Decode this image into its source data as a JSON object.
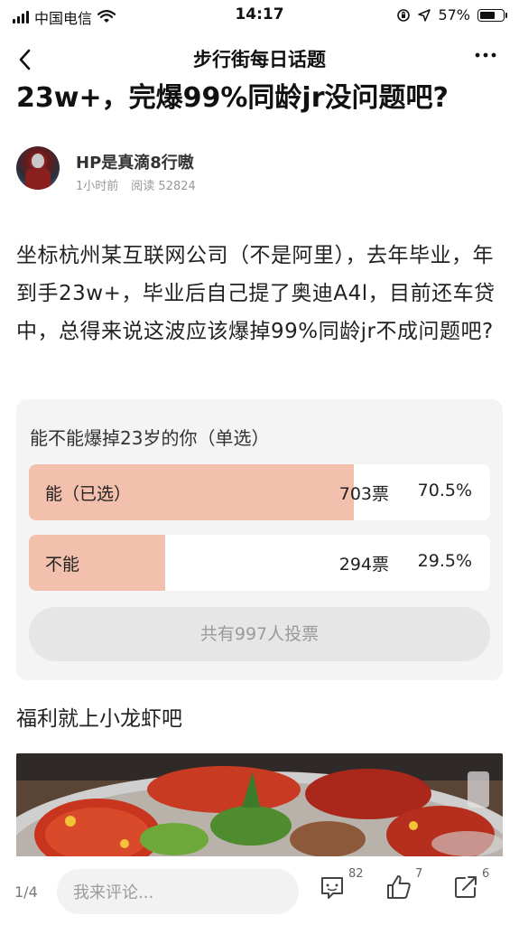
{
  "status_bar": {
    "carrier": "中国电信",
    "time": "14:17",
    "battery": "57%"
  },
  "nav": {
    "title": "步行街每日话题"
  },
  "post": {
    "title": "23w+，完爆99%同龄jr没问题吧?",
    "author": {
      "name": "HP是真滴8行嗷",
      "time_ago": "1小时前",
      "reads": "阅读 52824"
    },
    "body": "坐标杭州某互联网公司（不是阿里），去年毕业，年到手23w+，毕业后自己提了奥迪A4l，目前还车贷中，总得来说这波应该爆掉99%同龄jr不成问题吧?"
  },
  "poll": {
    "question": "能不能爆掉23岁的你（单选）",
    "options": [
      {
        "label": "能（已选）",
        "votes": "703票",
        "percent": "70.5%",
        "fraction": 0.705
      },
      {
        "label": "不能",
        "votes": "294票",
        "percent": "29.5%",
        "fraction": 0.295
      }
    ],
    "total": "共有997人投票",
    "bar_color": "#f3c0ad"
  },
  "section_heading": "福利就上小龙虾吧",
  "bottom": {
    "page_indicator": "1/4",
    "comment_placeholder": "我来评论...",
    "actions": [
      {
        "icon": "comment-icon",
        "count": "82"
      },
      {
        "icon": "thumbs-up-icon",
        "count": "7"
      },
      {
        "icon": "share-icon",
        "count": "6"
      }
    ]
  }
}
